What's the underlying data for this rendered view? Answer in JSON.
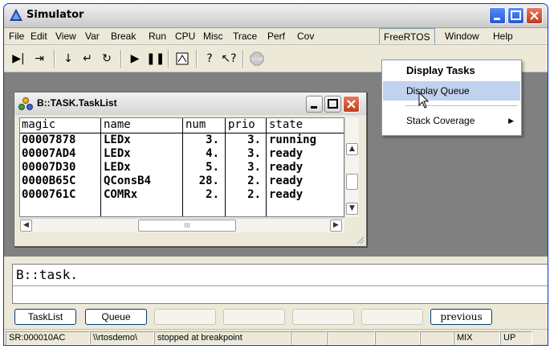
{
  "window": {
    "title": "Simulator"
  },
  "menubar": [
    "File",
    "Edit",
    "View",
    "Var",
    "Break",
    "Run",
    "CPU",
    "Misc",
    "Trace",
    "Perf",
    "Cov",
    "FreeRTOS",
    "Window",
    "Help"
  ],
  "freertos_menu": {
    "items": [
      {
        "label": "Display Tasks",
        "bold": true
      },
      {
        "label": "Display Queue",
        "hover": true
      },
      {
        "label": "Stack Coverage",
        "submenu": true
      }
    ]
  },
  "tasklist": {
    "title": "B::TASK.TaskList",
    "columns": [
      "magic",
      "name",
      "num",
      "prio",
      "state"
    ],
    "rows": [
      [
        "00007878",
        "LEDx",
        "3.",
        "3.",
        "running"
      ],
      [
        "00007AD4",
        "LEDx",
        "4.",
        "3.",
        "ready"
      ],
      [
        "00007D30",
        "LEDx",
        "5.",
        "3.",
        "ready"
      ],
      [
        "0000B65C",
        "QConsB4",
        "28.",
        "2.",
        "ready"
      ],
      [
        "0000761C",
        "COMRx",
        "2.",
        "2.",
        "ready"
      ]
    ],
    "hscroll_grip": "III"
  },
  "command": {
    "text": "B::task."
  },
  "buttons": {
    "tasklist": "TaskList",
    "queue": "Queue",
    "previous": "previous"
  },
  "status": {
    "address": "SR:000010AC",
    "source": "\\\\rtosdemo\\",
    "state": "stopped at breakpoint",
    "mode": "MIX",
    "direction": "UP"
  },
  "colors": {
    "menu_hover": "#c1d2ee",
    "workspace": "#808080",
    "close_button": "#c13b1c"
  }
}
